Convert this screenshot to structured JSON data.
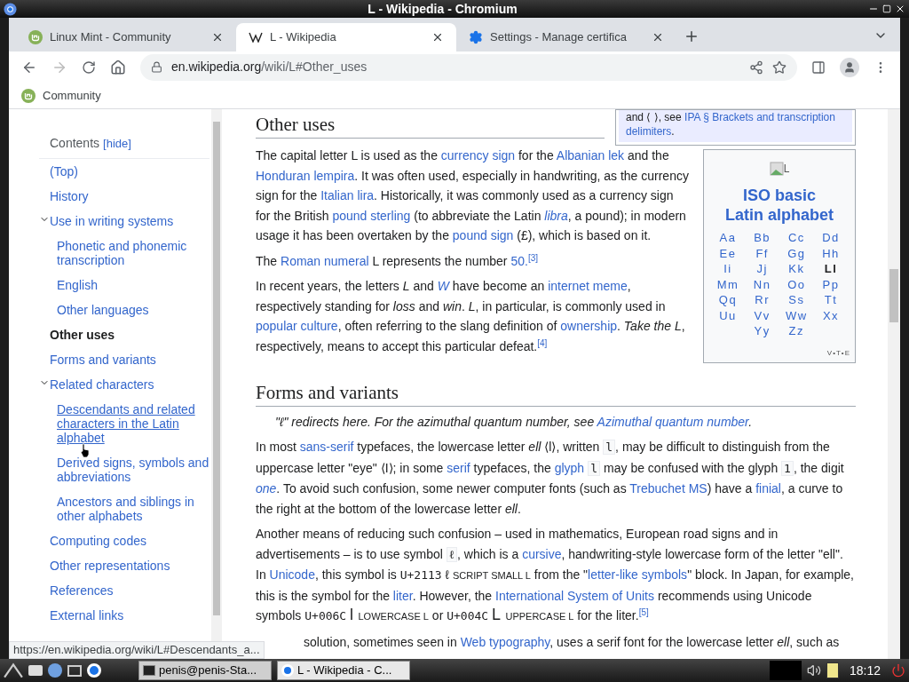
{
  "window": {
    "title": "L - Wikipedia - Chromium"
  },
  "tabs": [
    {
      "label": "Linux Mint - Community",
      "selected": false
    },
    {
      "label": "L - Wikipedia",
      "selected": true
    },
    {
      "label": "Settings - Manage certifica",
      "selected": false
    }
  ],
  "address": {
    "host": "en.wikipedia.org",
    "path": "/wiki/L#Other_uses"
  },
  "bookmarks": [
    {
      "label": "Community"
    }
  ],
  "toc": {
    "title": "Contents",
    "toggle": "[hide]",
    "items": [
      {
        "label": "(Top)",
        "selected": false,
        "hovered": false
      },
      {
        "label": "History",
        "selected": false,
        "hovered": false
      },
      {
        "label": "Use in writing systems",
        "selected": false,
        "hovered": false,
        "expanded": true,
        "children": [
          {
            "label": "Phonetic and phonemic transcription",
            "selected": false,
            "hovered": false
          },
          {
            "label": "English",
            "selected": false,
            "hovered": false
          },
          {
            "label": "Other languages",
            "selected": false,
            "hovered": false
          }
        ]
      },
      {
        "label": "Other uses",
        "selected": true,
        "hovered": false
      },
      {
        "label": "Forms and variants",
        "selected": false,
        "hovered": false
      },
      {
        "label": "Related characters",
        "selected": false,
        "hovered": false,
        "expanded": true,
        "children": [
          {
            "label": "Descendants and related characters in the Latin alphabet",
            "selected": false,
            "hovered": true
          },
          {
            "label": "Derived signs, symbols and abbreviations",
            "selected": false,
            "hovered": false
          },
          {
            "label": "Ancestors and siblings in other alphabets",
            "selected": false,
            "hovered": false
          }
        ]
      },
      {
        "label": "Computing codes",
        "selected": false,
        "hovered": false
      },
      {
        "label": "Other representations",
        "selected": false,
        "hovered": false
      },
      {
        "label": "References",
        "selected": false,
        "hovered": false
      },
      {
        "label": "External links",
        "selected": false,
        "hovered": false
      }
    ]
  },
  "hatnote_box": {
    "segments": [
      {
        "kind": "text",
        "text": "and ⟨ ⟩, see "
      },
      {
        "kind": "link",
        "text": "IPA § Brackets and transcription",
        "space_after": true
      },
      {
        "kind": "link",
        "text": "delimiters"
      },
      {
        "kind": "text",
        "text": "."
      }
    ]
  },
  "infobox": {
    "image_alt": "L",
    "title": "ISO basic Latin alphabet",
    "letters": [
      {
        "text": "Aa",
        "current": false
      },
      {
        "text": "Bb",
        "current": false
      },
      {
        "text": "Cc",
        "current": false
      },
      {
        "text": "Dd",
        "current": false
      },
      {
        "text": "Ee",
        "current": false
      },
      {
        "text": "Ff",
        "current": false
      },
      {
        "text": "Gg",
        "current": false
      },
      {
        "text": "Hh",
        "current": false
      },
      {
        "text": "Ii",
        "current": false
      },
      {
        "text": "Jj",
        "current": false
      },
      {
        "text": "Kk",
        "current": false
      },
      {
        "text": "Ll",
        "current": true
      },
      {
        "text": "Mm",
        "current": false
      },
      {
        "text": "Nn",
        "current": false
      },
      {
        "text": "Oo",
        "current": false
      },
      {
        "text": "Pp",
        "current": false
      },
      {
        "text": "Qq",
        "current": false
      },
      {
        "text": "Rr",
        "current": false
      },
      {
        "text": "Ss",
        "current": false
      },
      {
        "text": "Tt",
        "current": false
      },
      {
        "text": "Uu",
        "current": false
      },
      {
        "text": "Vv",
        "current": false
      },
      {
        "text": "Ww",
        "current": false
      },
      {
        "text": "Xx",
        "current": false
      },
      {
        "text": "Yy",
        "current": false
      },
      {
        "text": "Zz",
        "current": false
      }
    ],
    "nav": {
      "links": [
        "V",
        "T",
        "E"
      ],
      "separator": "•"
    }
  },
  "sections": [
    {
      "heading": "Other uses",
      "blocks": [
        {
          "kind": "paragraph",
          "segments": [
            {
              "kind": "text",
              "text": "The capital letter L is used as the "
            },
            {
              "kind": "link",
              "text": "currency sign"
            },
            {
              "kind": "text",
              "text": " for the "
            },
            {
              "kind": "link",
              "text": "Albanian lek"
            },
            {
              "kind": "text",
              "text": " and the "
            },
            {
              "kind": "link",
              "text": "Honduran lempira"
            },
            {
              "kind": "text",
              "text": ". It was often used, especially in handwriting, as the currency sign for the "
            },
            {
              "kind": "link",
              "text": "Italian lira"
            },
            {
              "kind": "text",
              "text": ". Historically, it was commonly used as a currency sign for the British "
            },
            {
              "kind": "link",
              "text": "pound sterling"
            },
            {
              "kind": "text",
              "text": " (to abbreviate the Latin "
            },
            {
              "kind": "link",
              "text": "*libra*"
            },
            {
              "kind": "text",
              "text": ", a pound); in modern usage it has been overtaken by the "
            },
            {
              "kind": "link",
              "text": "pound sign"
            },
            {
              "kind": "text",
              "text": " (£), which is based on it."
            }
          ]
        },
        {
          "kind": "paragraph",
          "segments": [
            {
              "kind": "text",
              "text": "The "
            },
            {
              "kind": "link",
              "text": "Roman numeral"
            },
            {
              "kind": "text",
              "text": " L represents the number "
            },
            {
              "kind": "link",
              "text": "50."
            },
            {
              "kind": "ref",
              "text": "[3]"
            }
          ]
        },
        {
          "kind": "paragraph",
          "segments": [
            {
              "kind": "text",
              "text": "In recent years, the letters *L* and "
            },
            {
              "kind": "link",
              "text": "*W*"
            },
            {
              "kind": "text",
              "text": " have become an "
            },
            {
              "kind": "link",
              "text": "internet meme"
            },
            {
              "kind": "text",
              "text": ", respectively standing for *loss* and *win*. *L*, in particular, is commonly used in "
            },
            {
              "kind": "link",
              "text": "popular culture"
            },
            {
              "kind": "text",
              "text": ", often referring to the slang definition of "
            },
            {
              "kind": "link",
              "text": "ownership"
            },
            {
              "kind": "text",
              "text": ". *Take the L*, respectively, means to accept this particular defeat."
            },
            {
              "kind": "ref",
              "text": "[4]"
            }
          ]
        }
      ]
    },
    {
      "heading": "Forms and variants",
      "blocks": [
        {
          "kind": "hatnote",
          "segments": [
            {
              "kind": "text",
              "text": "\"ℓ\" redirects here. For the azimuthal quantum number, see "
            },
            {
              "kind": "link",
              "text": "Azimuthal quantum number"
            },
            {
              "kind": "text",
              "text": "."
            }
          ]
        },
        {
          "kind": "paragraph",
          "segments": [
            {
              "kind": "text",
              "text": "In most "
            },
            {
              "kind": "link",
              "text": "sans-serif"
            },
            {
              "kind": "text",
              "text": " typefaces, the lowercase letter *ell* ⟨l⟩, written "
            },
            {
              "kind": "code",
              "text": "l"
            },
            {
              "kind": "text",
              "text": ", may be difficult to distinguish from the uppercase letter \"eye\" ⟨I⟩; in some "
            },
            {
              "kind": "link",
              "text": "serif"
            },
            {
              "kind": "text",
              "text": " typefaces, the "
            },
            {
              "kind": "link",
              "text": "glyph",
              "space_after": true
            },
            {
              "kind": "code",
              "text": "l"
            },
            {
              "kind": "text",
              "text": " may be confused with the glyph "
            },
            {
              "kind": "code",
              "text": "1"
            },
            {
              "kind": "text",
              "text": ", the digit "
            },
            {
              "kind": "link",
              "text": "*one*"
            },
            {
              "kind": "text",
              "text": ". To avoid such confusion, some newer computer fonts (such as "
            },
            {
              "kind": "link",
              "text": "Trebuchet MS"
            },
            {
              "kind": "text",
              "text": ") have a "
            },
            {
              "kind": "link",
              "text": "finial"
            },
            {
              "kind": "text",
              "text": ", a curve to the right at the bottom of the lowercase letter *ell*."
            }
          ]
        },
        {
          "kind": "paragraph",
          "segments": [
            {
              "kind": "text",
              "text": "Another means of reducing such confusion – used in mathematics, European road signs and in advertisements – is to use symbol "
            },
            {
              "kind": "code",
              "text": "ℓ"
            },
            {
              "kind": "text",
              "text": ", which is a "
            },
            {
              "kind": "link",
              "text": "cursive"
            },
            {
              "kind": "text",
              "text": ", handwriting-style lowercase form of the letter \"ell\". In "
            },
            {
              "kind": "link",
              "text": "Unicode"
            },
            {
              "kind": "text",
              "text": ", this symbol is "
            },
            {
              "kind": "mono",
              "text": "U+2113"
            },
            {
              "kind": "text",
              "text": " ℓ "
            },
            {
              "kind": "smallcaps",
              "text": "SCRIPT SMALL L"
            },
            {
              "kind": "text",
              "text": " from the \""
            },
            {
              "kind": "link",
              "text": "letter-like symbols"
            },
            {
              "kind": "text",
              "text": "\" block. In Japan, for example, this is the symbol for the "
            },
            {
              "kind": "link",
              "text": "liter"
            },
            {
              "kind": "text",
              "text": ". However, the "
            },
            {
              "kind": "link",
              "text": "International System of Units"
            },
            {
              "kind": "text",
              "text": " recommends using Unicode symbols "
            },
            {
              "kind": "mono",
              "text": "U+006C",
              "space_after": true
            },
            {
              "kind": "glyph",
              "text": "l",
              "space_after": true
            },
            {
              "kind": "smallcaps",
              "text": "LOWERCASE L"
            },
            {
              "kind": "text",
              "text": " or "
            },
            {
              "kind": "mono",
              "text": "U+004C",
              "space_after": true
            },
            {
              "kind": "glyph",
              "text": "L",
              "space_after": true
            },
            {
              "kind": "smallcaps",
              "text": "UPPERCASE L"
            },
            {
              "kind": "text",
              "text": " for the liter."
            },
            {
              "kind": "ref",
              "text": "[5]"
            }
          ]
        },
        {
          "kind": "partial",
          "segments": [
            {
              "kind": "text",
              "text": "solution, sometimes seen in "
            },
            {
              "kind": "link",
              "text": "Web typography"
            },
            {
              "kind": "text",
              "text": ", uses a serif font for the lowercase letter *ell*, such as"
            }
          ]
        }
      ]
    }
  ],
  "status_url": "https://en.wikipedia.org/wiki/L#Descendants_a...",
  "taskbar": {
    "tasks": [
      {
        "label": "penis@penis-Sta...",
        "selected": false
      },
      {
        "label": "L - Wikipedia - C...",
        "selected": true
      }
    ],
    "clock": "18:12"
  }
}
